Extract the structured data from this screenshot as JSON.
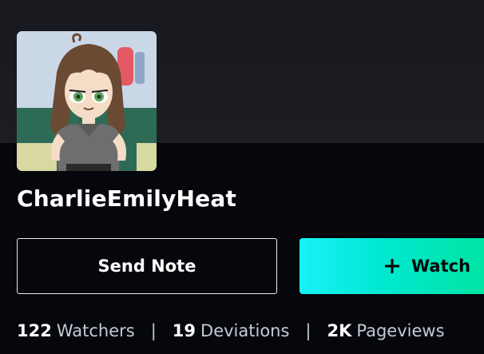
{
  "profile": {
    "username": "CharlieEmilyHeat"
  },
  "actions": {
    "send_note_label": "Send Note",
    "watch_label": "Watch"
  },
  "stats": {
    "watchers_count": "122",
    "watchers_label": "Watchers",
    "deviations_count": "19",
    "deviations_label": "Deviations",
    "pageviews_count": "2K",
    "pageviews_label": "Pageviews",
    "separator": "|"
  },
  "icons": {
    "watch": "plus-icon",
    "avatar": "avatar-image"
  },
  "colors": {
    "background": "#06070d",
    "cover": "#1a1c22",
    "watch_gradient_start": "#18f2f8",
    "watch_gradient_end": "#00e39a"
  }
}
